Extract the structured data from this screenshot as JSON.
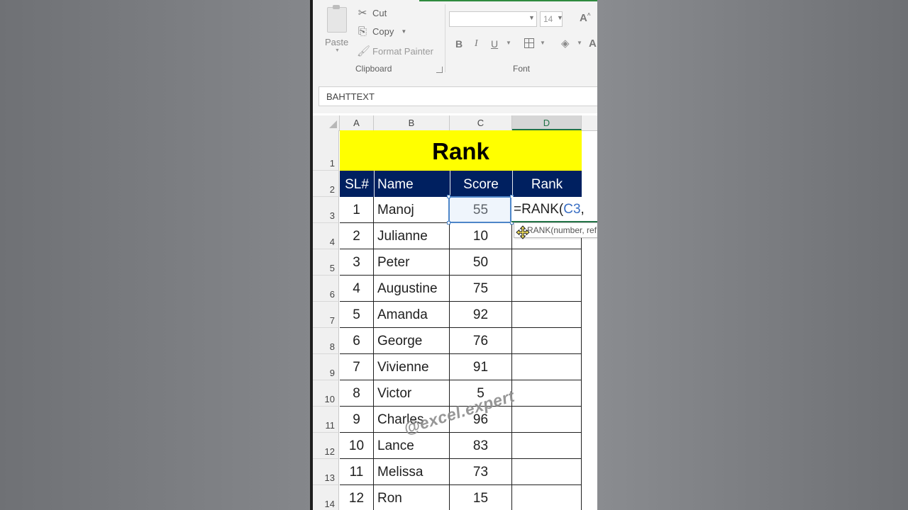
{
  "ribbon": {
    "clipboard": {
      "paste_label": "Paste",
      "cut_label": "Cut",
      "copy_label": "Copy",
      "format_painter_label": "Format Painter",
      "group_label": "Clipboard"
    },
    "font": {
      "font_name": "",
      "font_size": "14",
      "bold": "B",
      "italic": "I",
      "underline": "U",
      "grow_font": "A",
      "font_color": "A",
      "group_label": "Font"
    }
  },
  "name_box": {
    "value": "BAHTTEXT"
  },
  "columns": [
    "A",
    "B",
    "C",
    "D"
  ],
  "rows": [
    "1",
    "2",
    "3",
    "4",
    "5",
    "6",
    "7",
    "8",
    "9",
    "10",
    "11",
    "12",
    "13",
    "14"
  ],
  "sheet": {
    "title": "Rank",
    "headers": {
      "sl": "SL#",
      "name": "Name",
      "score": "Score",
      "rank": "Rank"
    },
    "data": [
      {
        "sl": "1",
        "name": "Manoj",
        "score": "55"
      },
      {
        "sl": "2",
        "name": "Julianne",
        "score": "10"
      },
      {
        "sl": "3",
        "name": "Peter",
        "score": "50"
      },
      {
        "sl": "4",
        "name": "Augustine",
        "score": "75"
      },
      {
        "sl": "5",
        "name": "Amanda",
        "score": "92"
      },
      {
        "sl": "6",
        "name": "George",
        "score": "76"
      },
      {
        "sl": "7",
        "name": "Vivienne",
        "score": "91"
      },
      {
        "sl": "8",
        "name": "Victor",
        "score": "5"
      },
      {
        "sl": "9",
        "name": "Charles",
        "score": "96"
      },
      {
        "sl": "10",
        "name": "Lance",
        "score": "83"
      },
      {
        "sl": "11",
        "name": "Melissa",
        "score": "73"
      },
      {
        "sl": "12",
        "name": "Ron",
        "score": "15"
      }
    ]
  },
  "editing": {
    "prefix": "=RANK(",
    "ref": "C3",
    "suffix": ",",
    "tooltip": "RANK(number, ref, [order])"
  },
  "watermark": "@excel.expert",
  "colors": {
    "title_fill": "#ffff00",
    "header_fill": "#002060",
    "accent_green": "#217346",
    "ref_blue": "#3a6fc4"
  }
}
